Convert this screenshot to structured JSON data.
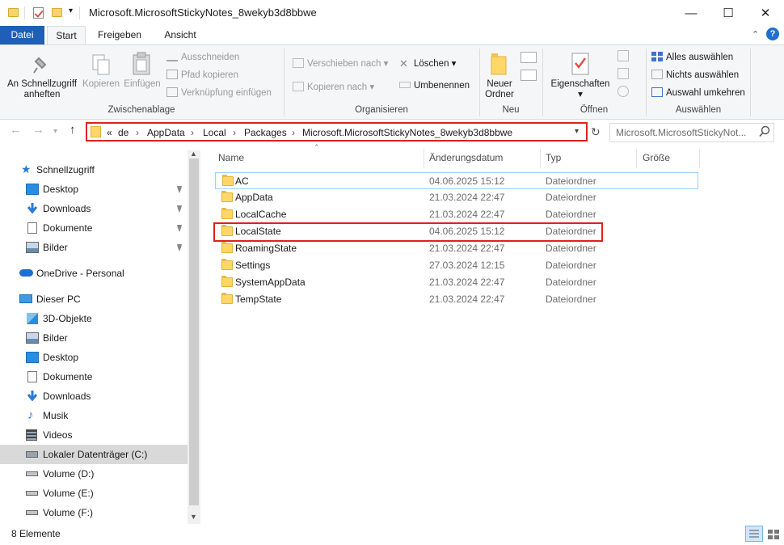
{
  "window": {
    "title": "Microsoft.MicrosoftStickyNotes_8wekyb3d8bbwe",
    "controls": {
      "minimize": "—",
      "maximize": "☐",
      "close": "✕"
    }
  },
  "ribbon_tabs": [
    "Datei",
    "Start",
    "Freigeben",
    "Ansicht"
  ],
  "ribbon": {
    "clipboard": {
      "label": "Zwischenablage",
      "pin_quick": [
        "An Schnellzugriff",
        "anheften"
      ],
      "copy": "Kopieren",
      "paste": "Einfügen",
      "cut": "Ausschneiden",
      "copy_path": "Pfad kopieren",
      "paste_shortcut": "Verknüpfung einfügen"
    },
    "organize": {
      "label": "Organisieren",
      "move_to": "Verschieben nach",
      "copy_to": "Kopieren nach",
      "delete": "Löschen",
      "rename": "Umbenennen"
    },
    "new": {
      "label": "Neu",
      "new_folder": [
        "Neuer",
        "Ordner"
      ]
    },
    "open": {
      "label": "Öffnen",
      "properties": "Eigenschaften"
    },
    "select": {
      "label": "Auswählen",
      "select_all": "Alles auswählen",
      "select_none": "Nichts auswählen",
      "invert": "Auswahl umkehren"
    }
  },
  "address": {
    "overflow": "«",
    "crumbs": [
      "de",
      "AppData",
      "Local",
      "Packages",
      "Microsoft.MicrosoftStickyNotes_8wekyb3d8bbwe"
    ],
    "search_placeholder": "Microsoft.MicrosoftStickyNot..."
  },
  "nav": {
    "quick_access": "Schnellzugriff",
    "quick_items": [
      "Desktop",
      "Downloads",
      "Dokumente",
      "Bilder"
    ],
    "onedrive": "OneDrive - Personal",
    "this_pc": "Dieser PC",
    "pc_items": [
      "3D-Objekte",
      "Bilder",
      "Desktop",
      "Dokumente",
      "Downloads",
      "Musik",
      "Videos",
      "Lokaler Datenträger (C:)",
      "Volume (D:)",
      "Volume (E:)",
      "Volume (F:)"
    ]
  },
  "columns": {
    "name": "Name",
    "date": "Änderungsdatum",
    "type": "Typ",
    "size": "Größe"
  },
  "files": [
    {
      "name": "AC",
      "date": "04.06.2025 15:12",
      "type": "Dateiordner"
    },
    {
      "name": "AppData",
      "date": "21.03.2024 22:47",
      "type": "Dateiordner"
    },
    {
      "name": "LocalCache",
      "date": "21.03.2024 22:47",
      "type": "Dateiordner"
    },
    {
      "name": "LocalState",
      "date": "04.06.2025 15:12",
      "type": "Dateiordner"
    },
    {
      "name": "RoamingState",
      "date": "21.03.2024 22:47",
      "type": "Dateiordner"
    },
    {
      "name": "Settings",
      "date": "27.03.2024 12:15",
      "type": "Dateiordner"
    },
    {
      "name": "SystemAppData",
      "date": "21.03.2024 22:47",
      "type": "Dateiordner"
    },
    {
      "name": "TempState",
      "date": "21.03.2024 22:47",
      "type": "Dateiordner"
    }
  ],
  "status": {
    "count": "8 Elemente"
  },
  "colors": {
    "accent": "#1f5fb5",
    "annotation": "#e02020",
    "selection": "#d9d9d9",
    "folder": "#ffd768"
  }
}
